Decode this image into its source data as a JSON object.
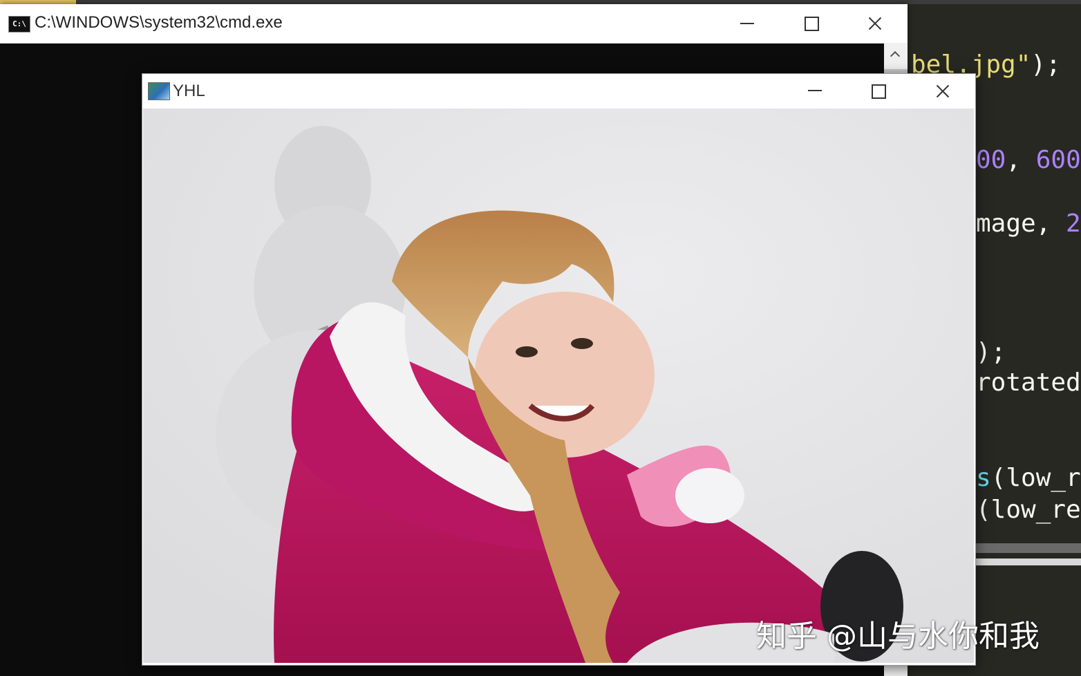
{
  "editor": {
    "lines": [
      {
        "parts": [
          {
            "t": "bel.jpg\"",
            "c": "str"
          },
          {
            "t": ");",
            "c": ""
          }
        ]
      },
      {
        "parts": [
          {
            "t": "00",
            "c": "num"
          },
          {
            "t": ", ",
            "c": ""
          },
          {
            "t": "600",
            "c": "num"
          }
        ]
      },
      {
        "parts": [
          {
            "t": "mage, ",
            "c": ""
          },
          {
            "t": "2",
            "c": "num"
          }
        ]
      },
      {
        "parts": [
          {
            "t": ");",
            "c": ""
          }
        ]
      },
      {
        "parts": [
          {
            "t": "rotated",
            "c": ""
          }
        ]
      },
      {
        "parts": [
          {
            "t": "s",
            "c": "fn"
          },
          {
            "t": "(low_r",
            "c": ""
          }
        ]
      },
      {
        "parts": [
          {
            "t": "(low_re",
            "c": ""
          }
        ]
      }
    ]
  },
  "cmd_window": {
    "title": "C:\\WINDOWS\\system32\\cmd.exe",
    "icon_text": "C:\\",
    "icon": "console-icon"
  },
  "image_window": {
    "title": "YHL",
    "icon": "image-window-icon"
  },
  "watermark": "知乎 @山与水你和我",
  "colors": {
    "jacket": "#c0185f",
    "fur": "#f2f2f2",
    "hair": "#c8965a",
    "snow": "#e4e4e6",
    "editor_bg": "#272822"
  }
}
